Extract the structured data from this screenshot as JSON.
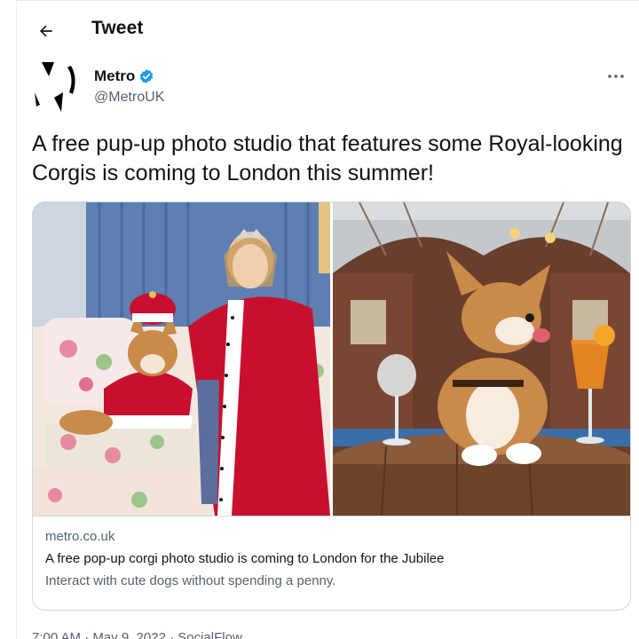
{
  "header": {
    "title": "Tweet"
  },
  "author": {
    "name": "Metro",
    "handle": "@MetroUK",
    "verified": true
  },
  "tweet": {
    "text": "A free pup-up photo studio that features some Royal-looking Corgis is coming to London this summer!"
  },
  "card": {
    "domain": "metro.co.uk",
    "title": "A free pop-up corgi photo studio is coming to London for the Jubilee",
    "description": "Interact with cute dogs without spending a penny."
  },
  "footer": {
    "timestamp": "7:00 AM · May 9, 2022 · SocialFlow"
  },
  "icons": {
    "back": "arrow-left-icon",
    "verified": "verified-badge-icon",
    "more": "more-horizontal-icon"
  },
  "colors": {
    "accent": "#1d9bf0",
    "secondary_text": "#536471",
    "border": "#cfd9de",
    "royal_red": "#c8102e"
  }
}
